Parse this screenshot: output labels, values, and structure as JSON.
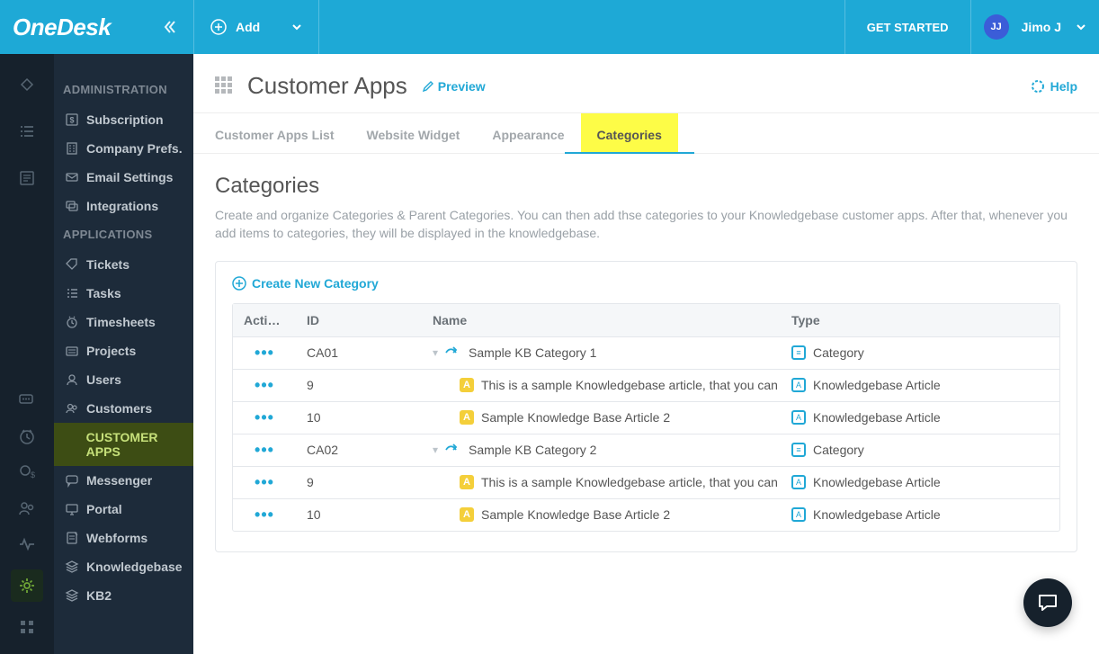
{
  "brand": {
    "name": "OneDesk"
  },
  "topbar": {
    "add_label": "Add",
    "get_started": "GET STARTED",
    "user_initials": "JJ",
    "user_name": "Jimo J"
  },
  "sidebar": {
    "groups": [
      {
        "heading": "ADMINISTRATION",
        "items": [
          {
            "label": "Subscription",
            "icon": "dollar"
          },
          {
            "label": "Company Prefs.",
            "icon": "building"
          },
          {
            "label": "Email Settings",
            "icon": "envelope"
          },
          {
            "label": "Integrations",
            "icon": "link"
          }
        ]
      },
      {
        "heading": "APPLICATIONS",
        "items": [
          {
            "label": "Tickets",
            "icon": "tag"
          },
          {
            "label": "Tasks",
            "icon": "list"
          },
          {
            "label": "Timesheets",
            "icon": "clock"
          },
          {
            "label": "Projects",
            "icon": "folder"
          },
          {
            "label": "Users",
            "icon": "user"
          },
          {
            "label": "Customers",
            "icon": "users"
          },
          {
            "label": "CUSTOMER APPS",
            "icon": "",
            "active": true
          },
          {
            "label": "Messenger",
            "icon": "chat"
          },
          {
            "label": "Portal",
            "icon": "monitor"
          },
          {
            "label": "Webforms",
            "icon": "form"
          },
          {
            "label": "Knowledgebase",
            "icon": "stack"
          },
          {
            "label": "KB2",
            "icon": "stack"
          }
        ]
      }
    ]
  },
  "page": {
    "title": "Customer Apps",
    "preview": "Preview",
    "help": "Help",
    "tabs": [
      {
        "label": "Customer Apps List",
        "active": false
      },
      {
        "label": "Website Widget",
        "active": false
      },
      {
        "label": "Appearance",
        "active": false
      },
      {
        "label": "Categories",
        "active": true,
        "highlight": true
      }
    ],
    "section_title": "Categories",
    "section_desc": "Create and organize Categories & Parent Categories. You can then add thse categories to your Knowledgebase customer apps. After that, whenever you add items to categories, they will be displayed in the knowledgebase.",
    "create_label": "Create New Category",
    "columns": {
      "actions": "Actions",
      "id": "ID",
      "name": "Name",
      "type": "Type"
    },
    "rows": [
      {
        "id": "CA01",
        "name": "Sample KB Category 1",
        "type": "Category",
        "kind": "category"
      },
      {
        "id": "9",
        "name": "This is a sample Knowledgebase article, that you can ret",
        "type": "Knowledgebase Article",
        "kind": "article"
      },
      {
        "id": "10",
        "name": "Sample Knowledge Base Article 2",
        "type": "Knowledgebase Article",
        "kind": "article"
      },
      {
        "id": "CA02",
        "name": "Sample KB Category 2",
        "type": "Category",
        "kind": "category"
      },
      {
        "id": "9",
        "name": "This is a sample Knowledgebase article, that you can ret",
        "type": "Knowledgebase Article",
        "kind": "article"
      },
      {
        "id": "10",
        "name": "Sample Knowledge Base Article 2",
        "type": "Knowledgebase Article",
        "kind": "article"
      }
    ]
  }
}
